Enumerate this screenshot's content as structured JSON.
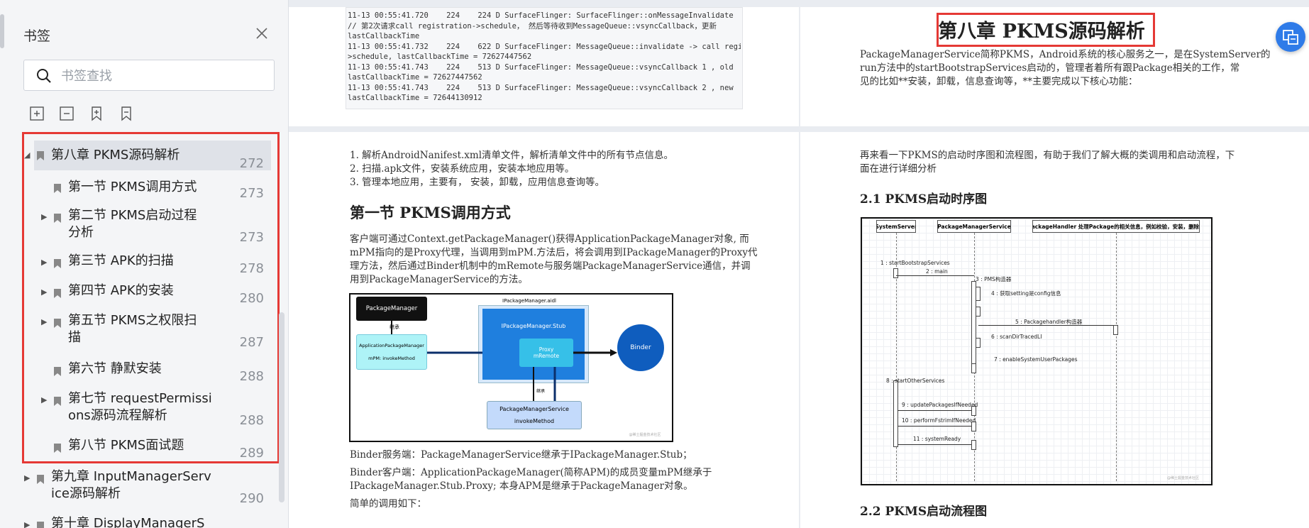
{
  "sidebar": {
    "title": "书签",
    "search_placeholder": "书签查找",
    "items": [
      {
        "label": "第八章 PKMS源码解析",
        "page": "272"
      },
      {
        "label": "第一节 PKMS调用方式",
        "page": "273"
      },
      {
        "label_line1": "第二节 PKMS启动过程",
        "label_line2": "分析",
        "page": "273"
      },
      {
        "label": "第三节 APK的扫描",
        "page": "278"
      },
      {
        "label": "第四节 APK的安装",
        "page": "280"
      },
      {
        "label_line1": "第五节 PKMS之权限扫",
        "label_line2": "描",
        "page": "287"
      },
      {
        "label": "第六节 静默安装",
        "page": "288"
      },
      {
        "label_line1": "第七节 requestPermissi",
        "label_line2": "ons源码流程解析",
        "page": "288"
      },
      {
        "label": "第八节 PKMS面试题",
        "page": "289"
      },
      {
        "label_line1": "第九章 InputManagerServ",
        "label_line2": "ice源码解析",
        "page": "290"
      },
      {
        "label": "第十章 DisplayManagerS",
        "page": ""
      }
    ]
  },
  "page1": {
    "code_lines": [
      "11-13 00:55:41.720    224    224 D SurfaceFlinger: SurfaceFlinger::onMessageInvalidate",
      "",
      "// 第2次请求call registration->schedule， 然后等待收到MessageQueue::vsyncCallback，更新",
      "lastCallbackTime",
      "11-13 00:55:41.732    224    622 D SurfaceFlinger: MessageQueue::invalidate -> call registration-",
      ">schedule, lastCallbackTime = 72627447562",
      "11-13 00:55:41.743    224    513 D SurfaceFlinger: MessageQueue::vsyncCallback 1 , old",
      "lastCallbackTime = 72627447562",
      "11-13 00:55:41.743    224    513 D SurfaceFlinger: MessageQueue::vsyncCallback 2 , new",
      "lastCallbackTime = 72644130912"
    ]
  },
  "page2": {
    "chapter_title": "第八章 PKMS源码解析",
    "intro": [
      "PackageManagerService简称PKMS，Android系统的核心服务之一，是在SystemServer的",
      "run方法中的startBootstrapServices启动的，管理者着所有跟Package相关的工作，常",
      "见的比如**安装，卸载，信息查询等，**主要完成以下核心功能："
    ]
  },
  "page3": {
    "list": [
      "1.   解析AndroidNanifest.xml清单文件，解析清单文件中的所有节点信息。",
      "2.   扫描.apk文件，安装系统应用，安装本地应用等。",
      "3.   管理本地应用，主要有， 安装，卸载，应用信息查询等。"
    ],
    "heading": "第一节 PKMS调用方式",
    "para": [
      "客户端可通过Context.getPackageManager()获得ApplicationPackageManager对象, 而",
      "mPM指向的是Proxy代理，当调用到mPM.方法后，将会调用到IPackageManager的Proxy代",
      "理方法，然后通过Binder机制中的mRemote与服务端PackageManagerService通信，并调",
      "用到PackageManagerService的方法。"
    ],
    "figure": {
      "aidl": "IPackageManager.aidl",
      "pm": "PackageManager",
      "inherit": "继承",
      "apm1": "ApplicationPackageManager",
      "apm2": "mPM: invokeMethod",
      "stub": "IPackageManager.Stub",
      "proxy1": "Proxy",
      "proxy2": "mRemote",
      "binder": "Binder",
      "pms1": "PackageManagerService",
      "pms2": "invokeMethod",
      "inherit2": "继承",
      "watermark": "@稀土掘金技术社区"
    },
    "after": [
      "Binder服务端：PackageManagerService继承于IPackageManager.Stub；",
      "Binder客户端：ApplicationPackageManager(简称APM)的成员变量mPM继承于",
      "IPackageManager.Stub.Proxy; 本身APM是继承于PackageManager对象。",
      "简单的调用如下："
    ]
  },
  "page4": {
    "para": [
      "再来看一下PKMS的启动时序图和流程图，有助于我们了解大概的类调用和启动流程，下",
      "面在进行详细分析"
    ],
    "h1": "2.1 PKMS启动时序图",
    "h2": "2.2 PKMS启动流程图",
    "seq": {
      "col1": "SystemServer",
      "col2": "PackageManagerService",
      "col3": "PackageHandler 处理Package的相关信息，例如校验，安装，删除等",
      "m1": "1 : startBootstrapServices",
      "m2": "2 : main",
      "m3": "3 : PMS构造器",
      "m4": "4 : 获取setting是config信息",
      "m5": "5 : Packagehandler构造器",
      "m6": "6 : scanDirTracedLI",
      "m7": "7 : enableSystemUserPackages",
      "m8": "8 : startOtherServices",
      "m9": "9 : updatePackagesIfNeeded",
      "m10": "10 : performFstrimIfNeeded",
      "m11": "11 : systemReady",
      "watermark": "@稀土掘金技术社区"
    }
  }
}
